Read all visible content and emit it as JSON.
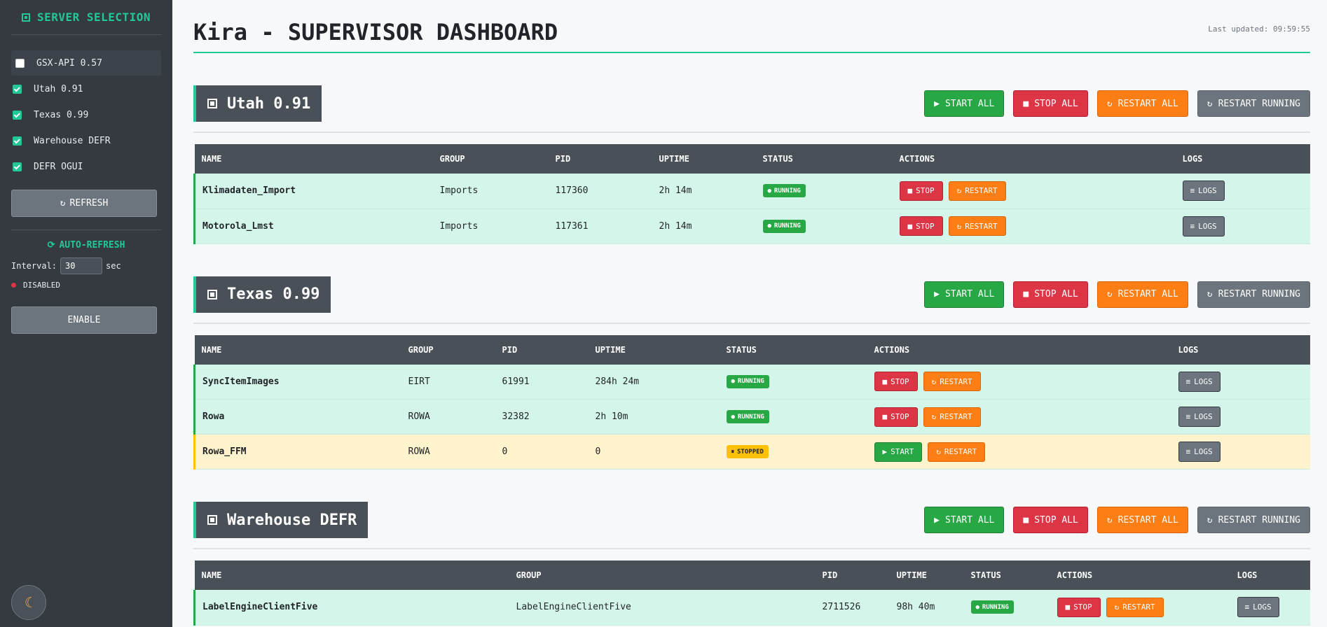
{
  "sidebar": {
    "title": "SERVER SELECTION",
    "servers": [
      {
        "label": "GSX-API 0.57",
        "checked": false
      },
      {
        "label": "Utah 0.91",
        "checked": true
      },
      {
        "label": "Texas 0.99",
        "checked": true
      },
      {
        "label": "Warehouse DEFR",
        "checked": true
      },
      {
        "label": "DEFR OGUI",
        "checked": true
      }
    ],
    "refresh_label": "REFRESH",
    "auto_refresh_title": "AUTO-REFRESH",
    "interval_label": "Interval:",
    "interval_value": "30",
    "interval_unit": "sec",
    "auto_status": "DISABLED",
    "enable_label": "ENABLE",
    "theme_icon": "moon-icon"
  },
  "header": {
    "title": "Kira - SUPERVISOR DASHBOARD",
    "last_updated": "Last updated: 09:59:55"
  },
  "bulk_labels": {
    "start_all": "START ALL",
    "stop_all": "STOP ALL",
    "restart_all": "RESTART ALL",
    "restart_running": "RESTART RUNNING"
  },
  "columns": [
    "NAME",
    "GROUP",
    "PID",
    "UPTIME",
    "STATUS",
    "ACTIONS",
    "LOGS"
  ],
  "action_labels": {
    "stop": "STOP",
    "start": "START",
    "restart": "RESTART",
    "logs": "LOGS"
  },
  "status_labels": {
    "running": "RUNNING",
    "stopped": "STOPPED"
  },
  "colors": {
    "accent": "#20c997",
    "running": "#28a745",
    "stopped": "#ffc107",
    "danger": "#dc3545",
    "warning": "#fd7e14"
  },
  "servers": [
    {
      "name": "Utah 0.91",
      "processes": [
        {
          "name": "Klimadaten_Import",
          "group": "Imports",
          "pid": "117360",
          "uptime": "2h 14m",
          "status": "running"
        },
        {
          "name": "Motorola_Lmst",
          "group": "Imports",
          "pid": "117361",
          "uptime": "2h 14m",
          "status": "running"
        }
      ]
    },
    {
      "name": "Texas 0.99",
      "processes": [
        {
          "name": "SyncItemImages",
          "group": "EIRT",
          "pid": "61991",
          "uptime": "284h 24m",
          "status": "running"
        },
        {
          "name": "Rowa",
          "group": "ROWA",
          "pid": "32382",
          "uptime": "2h 10m",
          "status": "running"
        },
        {
          "name": "Rowa_FFM",
          "group": "ROWA",
          "pid": "0",
          "uptime": "0",
          "status": "stopped"
        }
      ]
    },
    {
      "name": "Warehouse DEFR",
      "processes": [
        {
          "name": "LabelEngineClientFive",
          "group": "LabelEngineClientFive",
          "pid": "2711526",
          "uptime": "98h 40m",
          "status": "running"
        }
      ]
    }
  ]
}
